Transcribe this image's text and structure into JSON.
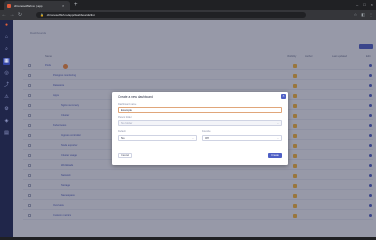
{
  "browser": {
    "tab_title": "chronosoffish.io | app",
    "tab_close": "×",
    "new_tab": "+",
    "url": "chronosoffish.io/app/dashboards/list",
    "window_controls": [
      "–",
      "□",
      "×"
    ],
    "nav": [
      "←",
      "→",
      "↻"
    ],
    "addr_icons": [
      "☆",
      "◧",
      "⋮"
    ]
  },
  "page": {
    "breadcrumb": "Dashboards",
    "columns": [
      "Name",
      "Visibility",
      "Author",
      "Last updated",
      "Edit"
    ]
  },
  "rows": [
    {
      "name": "Pods",
      "indent": 0,
      "flag": true,
      "author": "",
      "updated": ""
    },
    {
      "name": "Postgres monitoring",
      "indent": 1,
      "flag": false,
      "author": "",
      "updated": ""
    },
    {
      "name": "Datastore",
      "indent": 1,
      "flag": false,
      "author": "",
      "updated": ""
    },
    {
      "name": "Apps",
      "indent": 1,
      "flag": false,
      "author": "",
      "updated": ""
    },
    {
      "name": "Nginx summary",
      "indent": 2,
      "flag": false,
      "author": "",
      "updated": ""
    },
    {
      "name": "Cluster",
      "indent": 2,
      "flag": false,
      "author": "",
      "updated": ""
    },
    {
      "name": "Kubernetes",
      "indent": 1,
      "flag": false,
      "author": "",
      "updated": ""
    },
    {
      "name": "Ingress controller",
      "indent": 2,
      "flag": false,
      "author": "",
      "updated": ""
    },
    {
      "name": "Node exporter",
      "indent": 2,
      "flag": false,
      "author": "",
      "updated": ""
    },
    {
      "name": "Cluster usage",
      "indent": 2,
      "flag": false,
      "author": "",
      "updated": ""
    },
    {
      "name": "Workloads",
      "indent": 2,
      "flag": false,
      "author": "",
      "updated": ""
    },
    {
      "name": "Network",
      "indent": 2,
      "flag": false,
      "author": "",
      "updated": ""
    },
    {
      "name": "Storage",
      "indent": 2,
      "flag": false,
      "author": "",
      "updated": ""
    },
    {
      "name": "Namespace",
      "indent": 2,
      "flag": false,
      "author": "",
      "updated": ""
    },
    {
      "name": "Overview",
      "indent": 1,
      "flag": false,
      "author": "",
      "updated": ""
    },
    {
      "name": "Custom metrics",
      "indent": 1,
      "flag": false,
      "author": "",
      "updated": ""
    }
  ],
  "modal": {
    "title": "Create a new dashboard",
    "close": "×",
    "name_label": "Dashboard name",
    "name_value": "Example",
    "folder_label": "Parent folder",
    "folder_value": "No folder",
    "default_label": "Default",
    "default_value": "No",
    "favorite_label": "Favorite",
    "favorite_value": "Off",
    "cancel": "Cancel",
    "create": "Create"
  }
}
